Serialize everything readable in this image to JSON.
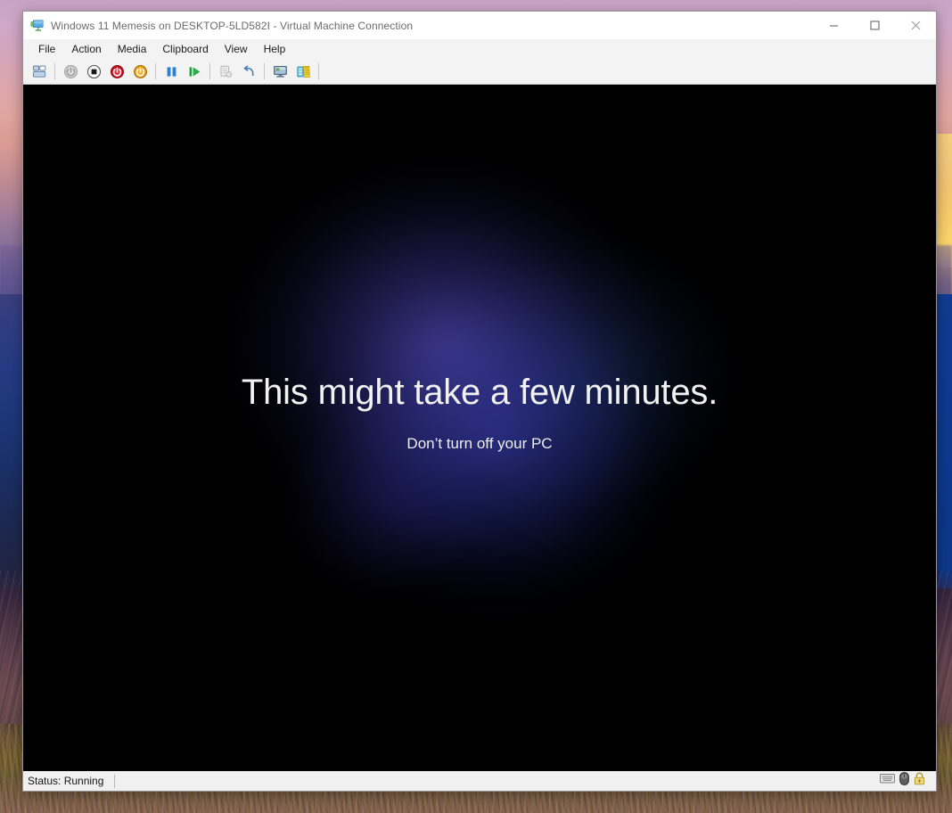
{
  "window": {
    "title": "Windows 11 Memesis on DESKTOP-5LD582I - Virtual Machine Connection",
    "title_icon": "virtual-machine-monitor-icon",
    "controls": {
      "minimize": "–",
      "maximize": "☐",
      "close": "✕"
    }
  },
  "menubar": {
    "items": [
      {
        "label": "File"
      },
      {
        "label": "Action"
      },
      {
        "label": "Media"
      },
      {
        "label": "Clipboard"
      },
      {
        "label": "View"
      },
      {
        "label": "Help"
      }
    ]
  },
  "toolbar": {
    "buttons": [
      {
        "name": "ctrl-alt-delete-icon",
        "tooltip": "Ctrl+Alt+Delete",
        "enabled": true
      },
      {
        "name": "start-icon",
        "tooltip": "Start",
        "enabled": false
      },
      {
        "name": "turn-off-icon",
        "tooltip": "Turn Off",
        "enabled": true
      },
      {
        "name": "shut-down-icon",
        "tooltip": "Shut Down",
        "enabled": true
      },
      {
        "name": "save-state-icon",
        "tooltip": "Save",
        "enabled": true
      },
      {
        "name": "pause-icon",
        "tooltip": "Pause",
        "enabled": true
      },
      {
        "name": "reset-icon",
        "tooltip": "Reset",
        "enabled": true
      },
      {
        "name": "checkpoint-icon",
        "tooltip": "Checkpoint",
        "enabled": false
      },
      {
        "name": "revert-icon",
        "tooltip": "Revert",
        "enabled": true
      },
      {
        "name": "enhanced-session-icon",
        "tooltip": "Enhanced Session",
        "enabled": true
      },
      {
        "name": "settings-icon",
        "tooltip": "Settings",
        "enabled": true
      }
    ]
  },
  "vm_screen": {
    "headline": "This might take a few minutes.",
    "subtext": "Don’t turn off your PC",
    "background_color": "#000000",
    "glow_color": "#3a36b4"
  },
  "statusbar": {
    "status": "Status: Running",
    "icons": [
      {
        "name": "keyboard-icon"
      },
      {
        "name": "mouse-icon"
      },
      {
        "name": "lock-icon"
      }
    ]
  },
  "desktop": {
    "wallpaper": "mountain-sunset-landscape",
    "sky_color": "#cfa6c4",
    "sunset_color": "#ffbf46",
    "mountain_color": "#23387c",
    "grass_color": "#74602f"
  }
}
